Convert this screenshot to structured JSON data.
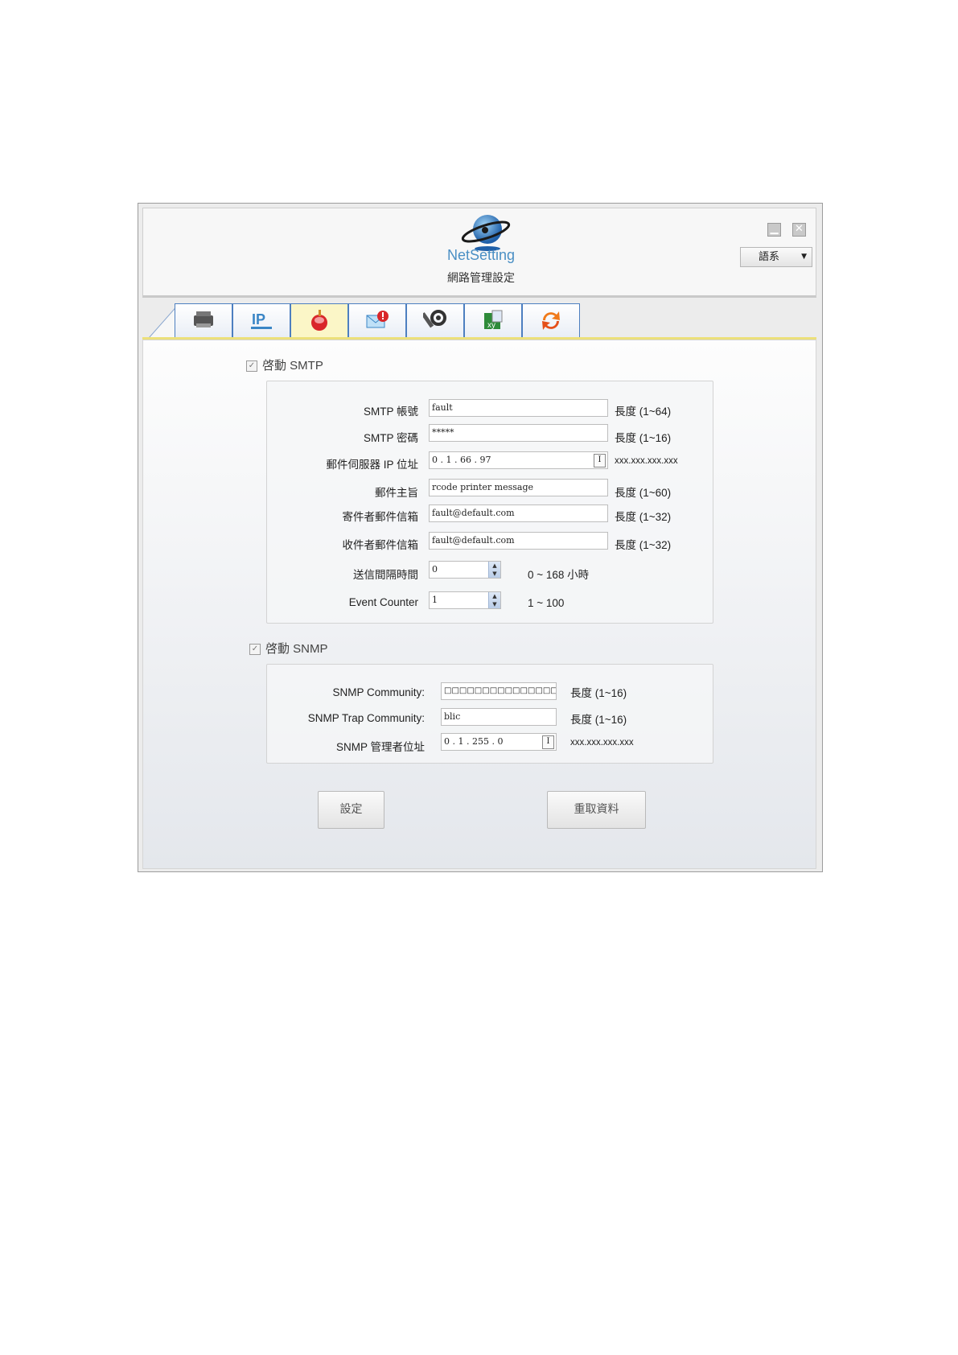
{
  "header": {
    "brand": "NetSetting",
    "subtitle": "網路管理設定",
    "language": "語系"
  },
  "tabs": [
    {
      "icon": "printer-icon"
    },
    {
      "icon": "ip-network-icon"
    },
    {
      "icon": "alert-bell-icon",
      "active": true
    },
    {
      "icon": "email-alert-icon"
    },
    {
      "icon": "tools-icon"
    },
    {
      "icon": "excel-icon"
    },
    {
      "icon": "refresh-icon"
    }
  ],
  "smtp": {
    "enable_label": "啓動 SMTP",
    "enabled": true,
    "fields": {
      "account": {
        "label": "SMTP 帳號",
        "value": "fault",
        "hint": "長度 (1~64)"
      },
      "password": {
        "label": "SMTP 密碼",
        "value": "*****",
        "hint": "長度 (1~16)"
      },
      "server_ip": {
        "label": "郵件伺服器 IP 位址",
        "value": "0 . 1 . 66 . 97",
        "hint": "xxx.xxx.xxx.xxx"
      },
      "subject": {
        "label": "郵件主旨",
        "value": "rcode printer message",
        "hint": "長度 (1~60)"
      },
      "sender": {
        "label": "寄件者郵件信箱",
        "value": "fault@default.com",
        "hint": "長度 (1~32)"
      },
      "recipient": {
        "label": "收件者郵件信箱",
        "value": "fault@default.com",
        "hint": "長度 (1~32)"
      },
      "interval": {
        "label": "送信間隔時間",
        "value": "0",
        "hint": "0 ~ 168 小時"
      },
      "event_counter": {
        "label": "Event Counter",
        "value": "1",
        "hint": "1 ~ 100"
      }
    }
  },
  "snmp": {
    "enable_label": "啓動 SNMP",
    "enabled": true,
    "fields": {
      "community": {
        "label": "SNMP Community:",
        "value": "□□□□□□□□□□□□□□□□",
        "hint": "長度 (1~16)"
      },
      "trap_community": {
        "label": "SNMP Trap Community:",
        "value": "blic",
        "hint": "長度 (1~16)"
      },
      "manager_ip": {
        "label": "SNMP 管理者位址",
        "value": "0 . 1 . 255 . 0",
        "hint": "xxx.xxx.xxx.xxx"
      }
    }
  },
  "buttons": {
    "set": "設定",
    "reload": "重取資料"
  },
  "ip_button_glyph": "I",
  "colors": {
    "tab_border": "#4d7fc0",
    "active_tab": "#fbf6c7",
    "brand": "#4a8fc4"
  }
}
